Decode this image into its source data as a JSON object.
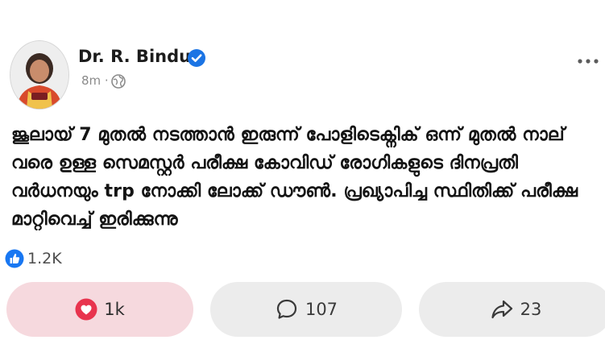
{
  "author": {
    "name": "Dr. R. Bindu",
    "time": "8m ·",
    "verified": true
  },
  "post": {
    "text": "ജൂലായ് 7 മുതൽ നടത്താൻ ഇരുന്ന് പോളിടെക്നിക് ഒന്ന് മുതൽ നാല് വരെ ഉള്ള സെമസ്റ്റർ പരീക്ഷ കോവിഡ് രോഗികളുടെ ദിനപ്രതി വർധനയും trp നോക്കി ലോക്ക് ഡൗൺ. പ്രഖ്യാപിച്ച സ്ഥിതിക്ക് പരീക്ഷ മാറ്റിവെച്ച് ഇരിക്കുന്നു"
  },
  "likes": {
    "count": "1.2K"
  },
  "actions": {
    "react_count": "1k",
    "comment_count": "107",
    "share_count": "23"
  },
  "colors": {
    "react_bg": "#f6d9de",
    "button_bg": "#ececec",
    "verified_blue": "#1b74e4",
    "heart_red": "#e8344e"
  },
  "icons": {
    "verified": "verified-badge-icon",
    "globe": "globe-icon",
    "more": "more-dots-icon",
    "like": "like-thumb-icon",
    "heart": "heart-icon",
    "comment": "comment-bubble-icon",
    "share": "share-arrow-icon"
  }
}
